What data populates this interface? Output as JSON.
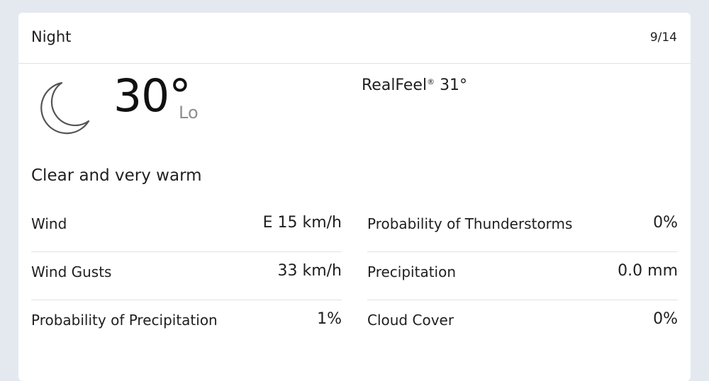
{
  "header": {
    "title": "Night",
    "date": "9/14"
  },
  "current": {
    "icon": "moon-icon",
    "temperature": "30°",
    "lo_label": "Lo",
    "realfeel_label": "RealFeel",
    "realfeel_mark": "®",
    "realfeel_value": "31°",
    "phrase": "Clear and very warm"
  },
  "details_left": [
    {
      "label": "Wind",
      "value": "E 15 km/h"
    },
    {
      "label": "Wind Gusts",
      "value": "33 km/h"
    },
    {
      "label": "Probability of Precipitation",
      "value": "1%"
    }
  ],
  "details_right": [
    {
      "label": "Probability of Thunderstorms",
      "value": "0%"
    },
    {
      "label": "Precipitation",
      "value": "0.0 mm"
    },
    {
      "label": "Cloud Cover",
      "value": "0%"
    }
  ],
  "colors": {
    "background": "#e4e9f0",
    "card": "#ffffff",
    "text": "#1f1f1f",
    "muted": "#8e8e8e",
    "divider": "#e2e2e2"
  }
}
